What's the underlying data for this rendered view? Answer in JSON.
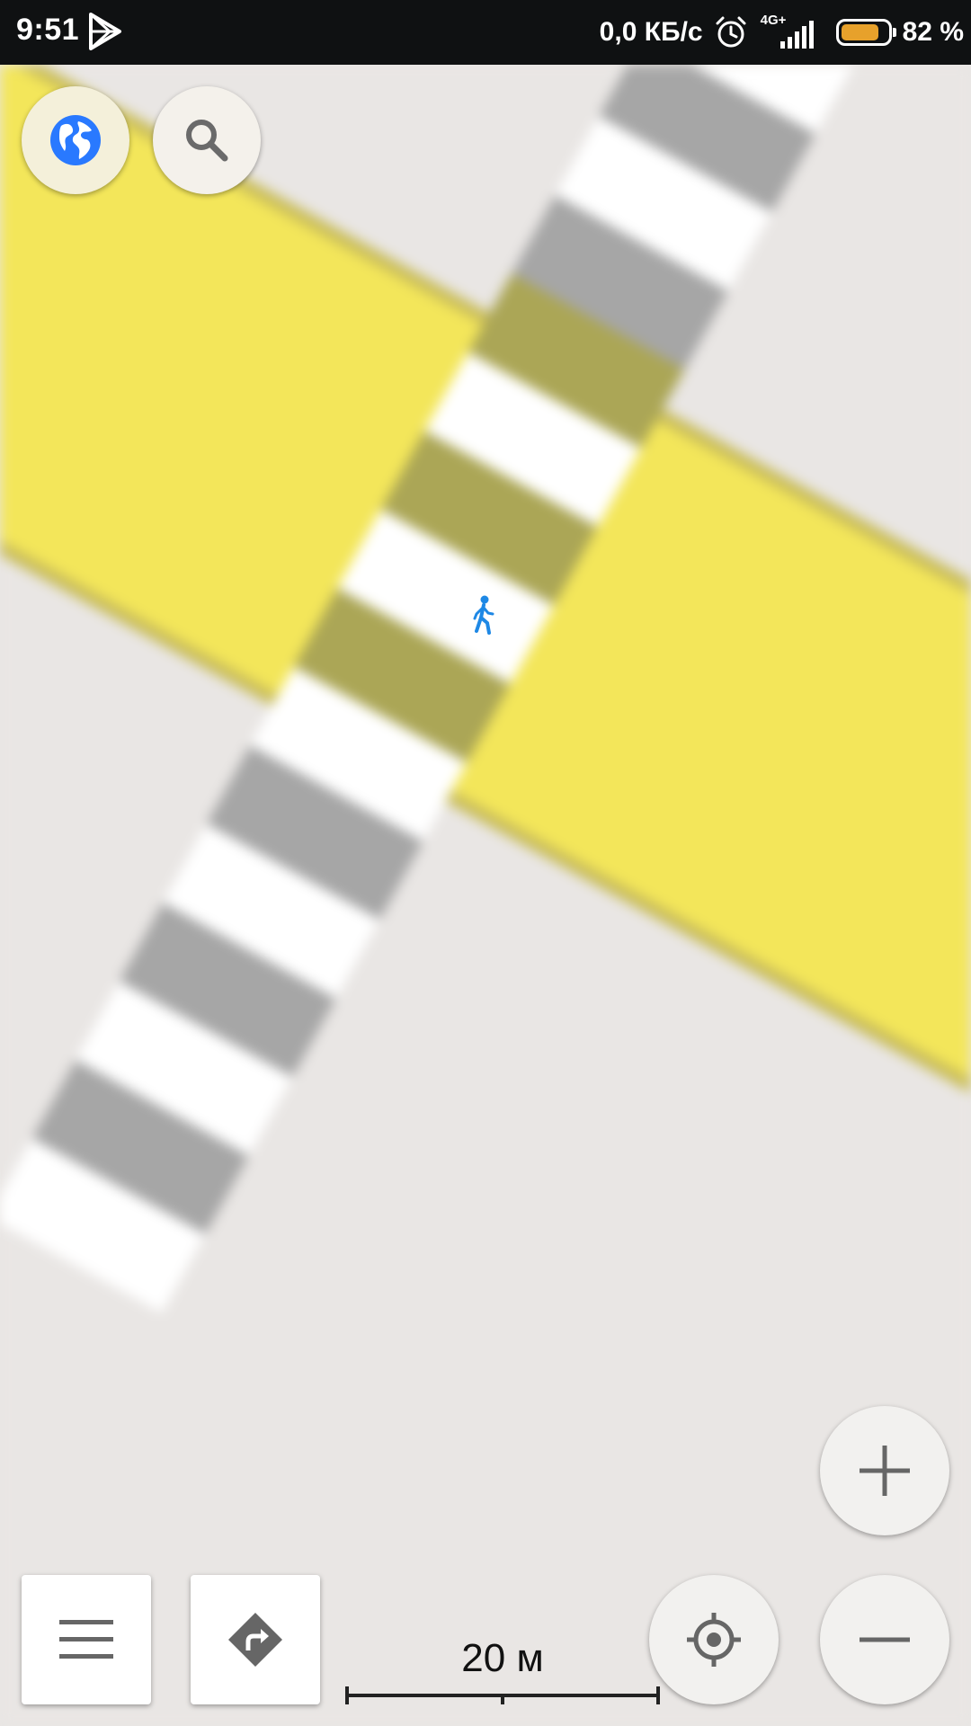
{
  "status_bar": {
    "time": "9:51",
    "network_speed": "0,0 КБ/с",
    "network_type": "4G+",
    "battery_percent_text": "82 %",
    "battery_level": 0.82,
    "icons": [
      "play-store-icon",
      "alarm-icon",
      "signal-icon",
      "battery-icon"
    ]
  },
  "map": {
    "user_marker": "pedestrian-icon",
    "colors": {
      "background": "#e9e6e4",
      "road": "#f3e65a",
      "road_edge": "#c9bd5a",
      "crosswalk_white": "#ffffff",
      "crosswalk_gray": "#a6a6a6",
      "crosswalk_on_road": "#aba656",
      "marker": "#1e88e5"
    }
  },
  "controls": {
    "globe_button": {
      "icon": "globe-icon",
      "color": "#2979ff"
    },
    "search_button": {
      "icon": "search-icon"
    },
    "zoom_in_button": {
      "icon": "plus-icon"
    },
    "zoom_out_button": {
      "icon": "minus-icon"
    },
    "locate_button": {
      "icon": "crosshair-icon"
    },
    "menu_button": {
      "icon": "hamburger-menu-icon"
    },
    "route_button": {
      "icon": "route-turn-icon"
    }
  },
  "scale": {
    "label": "20 м"
  }
}
